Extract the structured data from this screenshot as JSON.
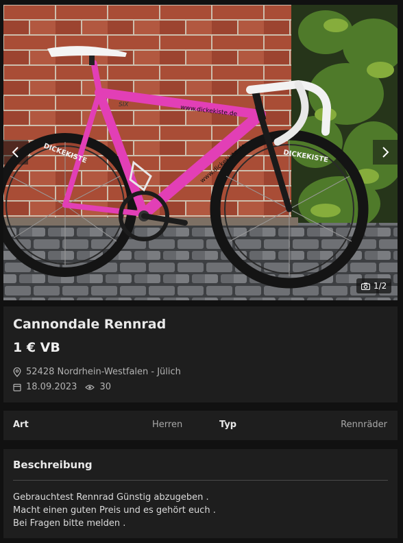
{
  "gallery": {
    "image_alt": "Pink Cannondale road bike leaning against a brick wall",
    "frame_decal": "www.dickekiste.de",
    "seat_tube_decal": "www.dickekiste.de",
    "model_decal": "SIX",
    "wheel_decal": "DICKEKISTE",
    "counter": "1/2",
    "prev_icon": "chevron-left-icon",
    "next_icon": "chevron-right-icon",
    "camera_icon": "camera-icon"
  },
  "listing": {
    "title": "Cannondale Rennrad",
    "price": "1 € VB",
    "location": "52428 Nordrhein-Westfalen - Jülich",
    "date": "18.09.2023",
    "views": "30",
    "location_icon": "map-pin-icon",
    "date_icon": "calendar-icon",
    "views_icon": "eye-icon"
  },
  "attributes": [
    {
      "key": "Art",
      "value": "Herren"
    },
    {
      "key": "Typ",
      "value": "Rennräder"
    }
  ],
  "description": {
    "title": "Beschreibung",
    "lines": [
      "Gebrauchtest Rennrad Günstig abzugeben .",
      "Macht einen guten Preis und es gehört euch .",
      "Bei Fragen bitte melden ."
    ]
  },
  "colors": {
    "page_background": "#111111",
    "card_background": "#1e1e1e",
    "frame_pink": "#e23fb6",
    "brick": "#a34a33"
  }
}
